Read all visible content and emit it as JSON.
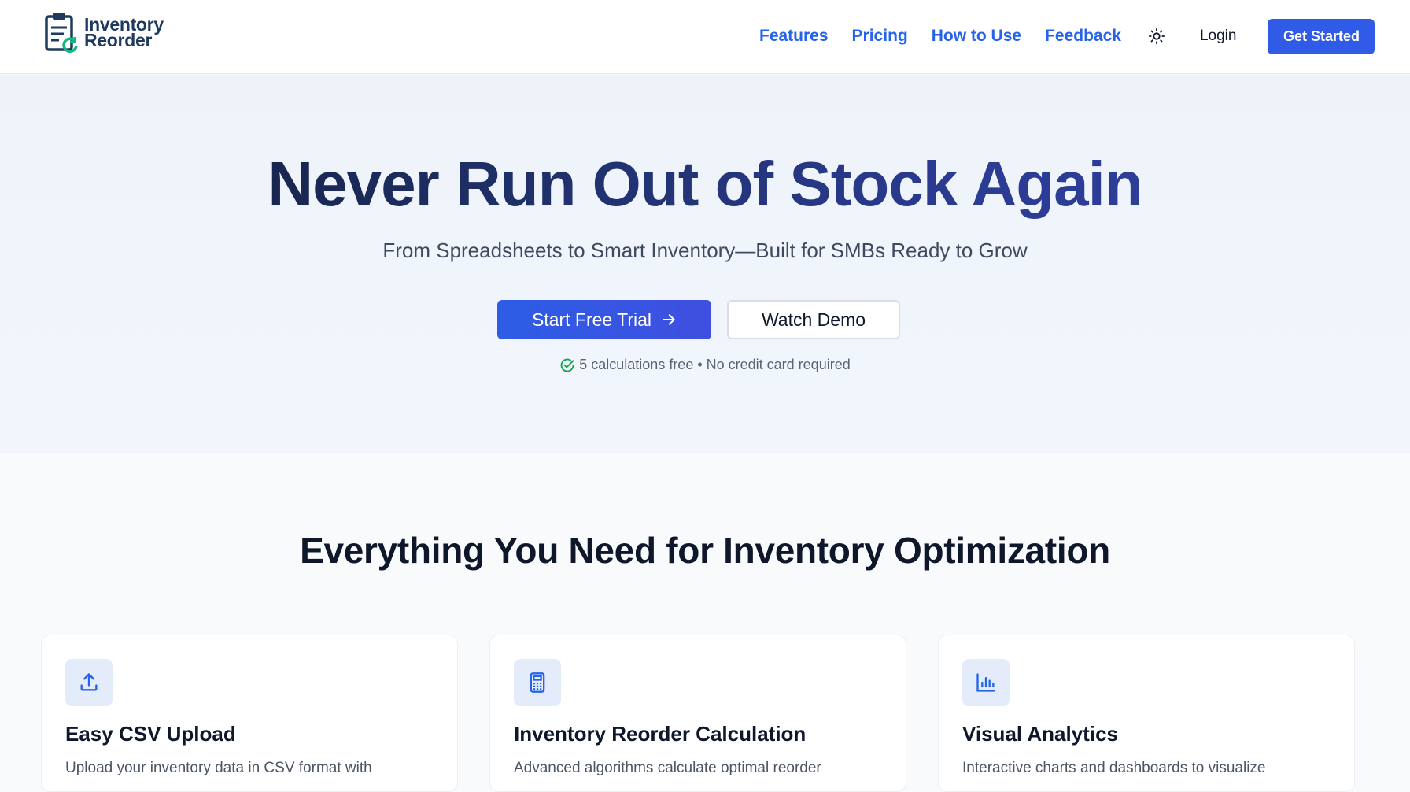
{
  "brand": {
    "name_line1": "Inventory",
    "name_line2": "Reorder"
  },
  "nav": {
    "links": [
      "Features",
      "Pricing",
      "How to Use",
      "Feedback"
    ],
    "theme_toggle_icon": "sun-icon",
    "login_label": "Login",
    "cta_label": "Get Started"
  },
  "hero": {
    "title": "Never Run Out of Stock Again",
    "subtitle": "From Spreadsheets to Smart Inventory—Built for SMBs Ready to Grow",
    "primary_label": "Start Free Trial",
    "secondary_label": "Watch Demo",
    "note": "5 calculations free • No credit card required"
  },
  "features": {
    "heading": "Everything You Need for Inventory Optimization",
    "cards": [
      {
        "icon": "upload-icon",
        "title": "Easy CSV Upload",
        "desc": "Upload your inventory data in CSV format with"
      },
      {
        "icon": "calculator-icon",
        "title": "Inventory Reorder Calculation",
        "desc": "Advanced algorithms calculate optimal reorder"
      },
      {
        "icon": "bar-chart-icon",
        "title": "Visual Analytics",
        "desc": "Interactive charts and dashboards to visualize"
      }
    ]
  },
  "colors": {
    "primary": "#2f5be6",
    "nav_link": "#2563eb",
    "heading": "#0f172a",
    "success": "#16a34a",
    "logo_accent": "#10b981"
  }
}
